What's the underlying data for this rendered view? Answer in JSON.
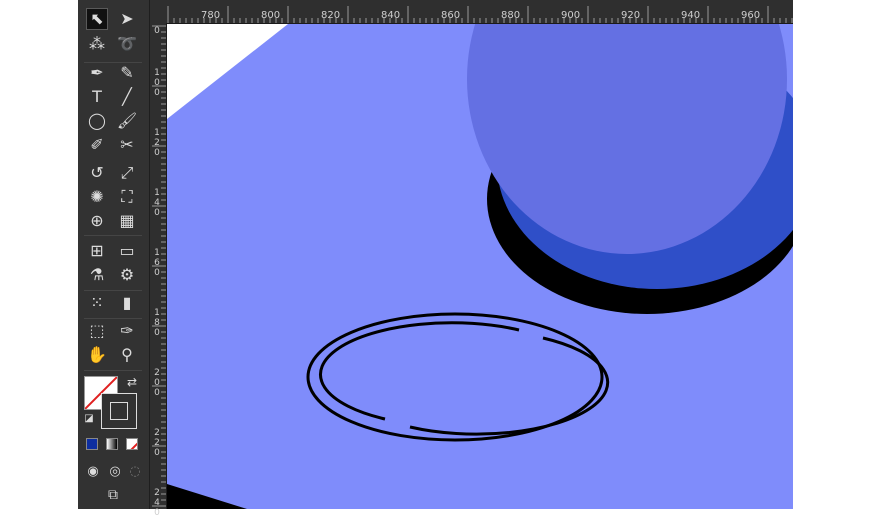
{
  "ruler": {
    "top_labels": [
      "780",
      "800",
      "820",
      "840",
      "860",
      "880",
      "900",
      "920",
      "940",
      "960"
    ],
    "left_labels": [
      "0",
      "100",
      "120",
      "140",
      "160",
      "180",
      "200",
      "220",
      "240"
    ]
  },
  "tools": [
    {
      "name": "selection-tool-icon",
      "glyph": "⬉"
    },
    {
      "name": "direct-selection-tool-icon",
      "glyph": "➤"
    },
    {
      "name": "magic-wand-tool-icon",
      "glyph": "⁂"
    },
    {
      "name": "lasso-tool-icon",
      "glyph": "➰"
    },
    {
      "name": "pen-tool-icon",
      "glyph": "✒"
    },
    {
      "name": "curvature-tool-icon",
      "glyph": "✎"
    },
    {
      "name": "type-tool-icon",
      "glyph": "T"
    },
    {
      "name": "line-segment-tool-icon",
      "glyph": "╱"
    },
    {
      "name": "ellipse-tool-icon",
      "glyph": "◯"
    },
    {
      "name": "paintbrush-tool-icon",
      "glyph": "🖌"
    },
    {
      "name": "shaper-tool-icon",
      "glyph": "✐"
    },
    {
      "name": "scissors-tool-icon",
      "glyph": "✂"
    },
    {
      "name": "rotate-tool-icon",
      "glyph": "↺"
    },
    {
      "name": "scale-tool-icon",
      "glyph": "⤢"
    },
    {
      "name": "warp-tool-icon",
      "glyph": "✺"
    },
    {
      "name": "free-transform-tool-icon",
      "glyph": "⛶"
    },
    {
      "name": "shape-builder-tool-icon",
      "glyph": "⊕"
    },
    {
      "name": "perspective-grid-tool-icon",
      "glyph": "▦"
    },
    {
      "name": "mesh-tool-icon",
      "glyph": "⊞"
    },
    {
      "name": "gradient-tool-icon",
      "glyph": "▭"
    },
    {
      "name": "eyedropper-tool-icon",
      "glyph": "⚗"
    },
    {
      "name": "blend-tool-icon",
      "glyph": "⚙"
    },
    {
      "name": "symbol-sprayer-tool-icon",
      "glyph": "⁙"
    },
    {
      "name": "column-graph-tool-icon",
      "glyph": "▮"
    },
    {
      "name": "artboard-tool-icon",
      "glyph": "⬚"
    },
    {
      "name": "slice-tool-icon",
      "glyph": "✑"
    },
    {
      "name": "hand-tool-icon",
      "glyph": "✋"
    },
    {
      "name": "zoom-tool-icon",
      "glyph": "⚲"
    }
  ],
  "colors": {
    "panel": "#323232",
    "plane": "#7f8cfb",
    "sphere": "#6470e3",
    "sphere_shadow": "#2f4fc8",
    "outline": "#000000",
    "fill_swatch_color": "#0d2ea0"
  }
}
